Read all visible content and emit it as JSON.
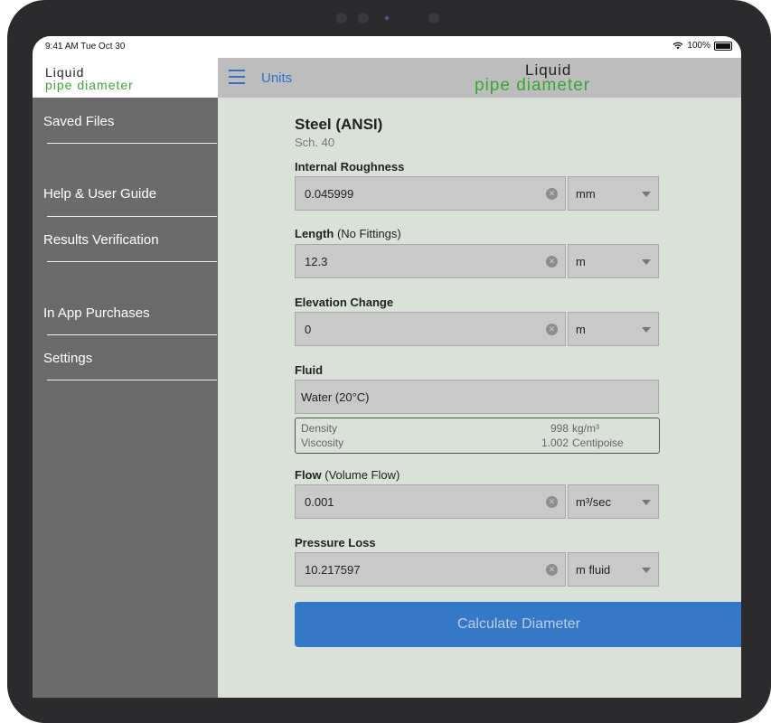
{
  "status_bar": {
    "time": "9:41 AM  Tue Oct 30",
    "battery": "100%"
  },
  "sidebar": {
    "logo_line1": "Liquid",
    "logo_line2": "pipe diameter",
    "items": [
      {
        "label": "Saved Files"
      },
      {
        "label": "Help & User Guide"
      },
      {
        "label": "Results Verification"
      },
      {
        "label": "In App Purchases"
      },
      {
        "label": "Settings"
      }
    ]
  },
  "topbar": {
    "units_label": "Units",
    "logo_line1": "Liquid",
    "logo_line2": "pipe diameter"
  },
  "form": {
    "pipe_material": "Steel (ANSI)",
    "pipe_schedule": "Sch. 40",
    "roughness": {
      "label": "Internal Roughness",
      "value": "0.045999",
      "unit": "mm"
    },
    "length": {
      "label": "Length",
      "note": "(No Fittings)",
      "value": "12.3",
      "unit": "m"
    },
    "elevation": {
      "label": "Elevation Change",
      "value": "0",
      "unit": "m"
    },
    "fluid": {
      "label": "Fluid",
      "value": "Water (20°C)",
      "density_label": "Density",
      "density_value": "998",
      "density_unit": "kg/m³",
      "viscosity_label": "Viscosity",
      "viscosity_value": "1.002",
      "viscosity_unit": "Centipoise"
    },
    "flow": {
      "label": "Flow",
      "note": "(Volume Flow)",
      "value": "0.001",
      "unit": "m³/sec"
    },
    "pressure_loss": {
      "label": "Pressure Loss",
      "value": "10.217597",
      "unit": "m fluid"
    },
    "calculate_label": "Calculate Diameter"
  },
  "colors": {
    "accent_blue": "#3579c6",
    "logo_green": "#36a832",
    "content_bg": "#d9e1d8",
    "sidebar_bg": "#6b6b6b"
  }
}
